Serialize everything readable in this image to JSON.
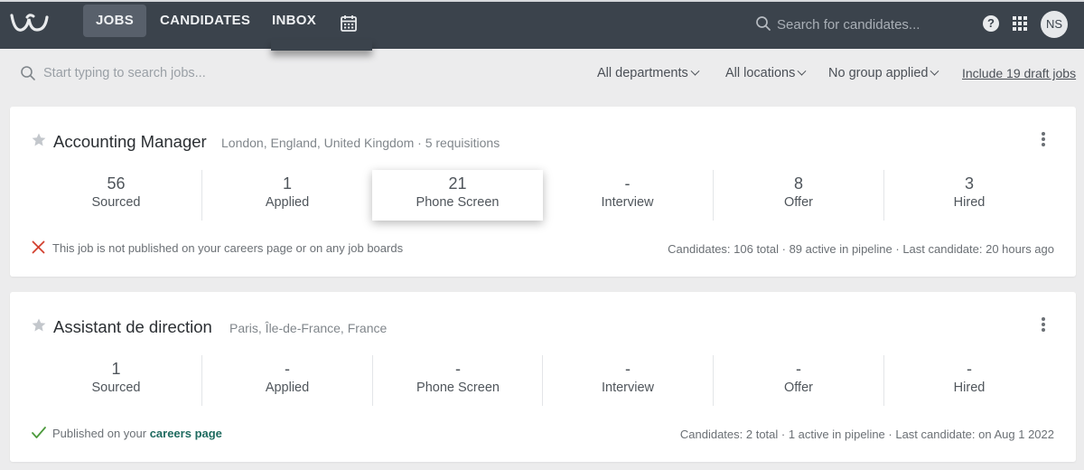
{
  "nav": {
    "items": [
      {
        "label": "JOBS",
        "active": true
      },
      {
        "label": "CANDIDATES",
        "active": false
      },
      {
        "label": "INBOX",
        "active": false
      }
    ],
    "calendar_icon": "calendar-icon",
    "search_placeholder": "Search for candidates...",
    "help_label": "?",
    "avatar_initials": "NS"
  },
  "filters": {
    "search_placeholder": "Start typing to search jobs...",
    "department": "All departments",
    "location": "All locations",
    "group": "No group applied",
    "draft_link": "Include 19 draft jobs"
  },
  "jobs": [
    {
      "title": "Accounting Manager",
      "meta": "London, England, United Kingdom · 5 requisitions",
      "stages": [
        {
          "value": "56",
          "label": "Sourced"
        },
        {
          "value": "1",
          "label": "Applied"
        },
        {
          "value": "21",
          "label": "Phone Screen"
        },
        {
          "value": "-",
          "label": "Interview"
        },
        {
          "value": "8",
          "label": "Offer"
        },
        {
          "value": "3",
          "label": "Hired"
        }
      ],
      "status_icon": "cross-icon",
      "status_text": "This job is not published on your careers page or on any job boards",
      "stats": "Candidates: 106 total · 89 active in pipeline · Last candidate: 20 hours ago"
    },
    {
      "title": "Assistant de direction",
      "meta": "Paris, Île-de-France, France",
      "stages": [
        {
          "value": "1",
          "label": "Sourced"
        },
        {
          "value": "-",
          "label": "Applied"
        },
        {
          "value": "-",
          "label": "Phone Screen"
        },
        {
          "value": "-",
          "label": "Interview"
        },
        {
          "value": "-",
          "label": "Offer"
        },
        {
          "value": "-",
          "label": "Hired"
        }
      ],
      "status_icon": "check-icon",
      "status_text": "Published on your ",
      "status_link": "careers page",
      "stats": "Candidates: 2 total · 1 active in pipeline · Last candidate: on Aug 1 2022"
    }
  ],
  "colors": {
    "topbar": "#3b434c",
    "accent_green": "#1f6b60",
    "error_red": "#d2402f",
    "success_green": "#4c9a3c"
  }
}
